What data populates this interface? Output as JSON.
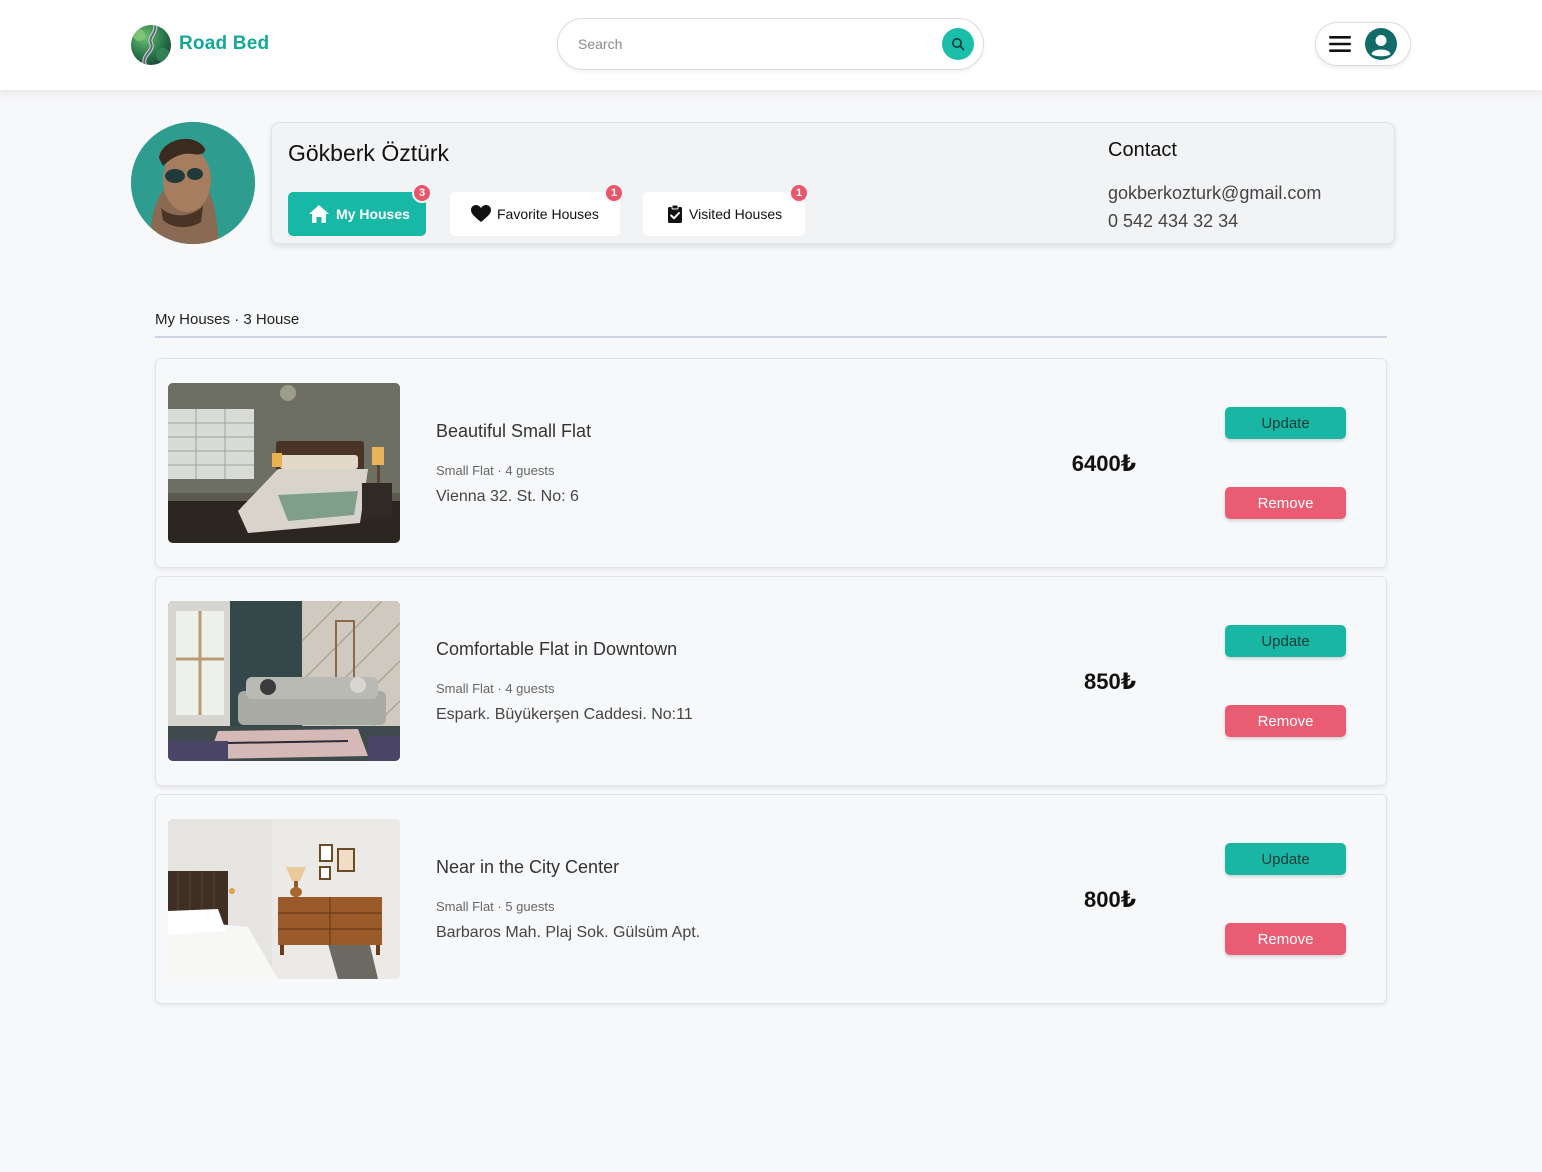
{
  "header": {
    "brand": "Road Bed",
    "search_placeholder": "Search"
  },
  "profile": {
    "name": "Gökberk Öztürk",
    "tabs": [
      {
        "label": "My Houses",
        "count": "3",
        "active": true
      },
      {
        "label": "Favorite Houses",
        "count": "1",
        "active": false
      },
      {
        "label": "Visited Houses",
        "count": "1",
        "active": false
      }
    ],
    "contact_title": "Contact",
    "email": "gokberkozturk@gmail.com",
    "phone": "0 542 434 32 34"
  },
  "listing": {
    "heading": "My Houses · 3 House",
    "houses": [
      {
        "title": "Beautiful Small Flat",
        "meta": "Small Flat · 4 guests",
        "address": "Vienna 32. St. No: 6",
        "price": "6400₺",
        "update_label": "Update",
        "remove_label": "Remove"
      },
      {
        "title": "Comfortable Flat in Downtown",
        "meta": "Small Flat · 4 guests",
        "address": "Espark. Büyükerşen Caddesi. No:11",
        "price": "850₺",
        "update_label": "Update",
        "remove_label": "Remove"
      },
      {
        "title": "Near in the City Center",
        "meta": "Small Flat · 5 guests",
        "address": "Barbaros Mah. Plaj Sok. Gülsüm Apt.",
        "price": "800₺",
        "update_label": "Update",
        "remove_label": "Remove"
      }
    ]
  },
  "colors": {
    "accent": "#17b8a6",
    "danger": "#e95c72",
    "background": "#f7f8fa"
  },
  "icons": {
    "search": "search-icon",
    "menu": "hamburger-menu-icon",
    "account": "user-avatar-icon",
    "my_houses": "home-icon",
    "favorites": "heart-icon",
    "visited": "clipboard-check-icon"
  }
}
